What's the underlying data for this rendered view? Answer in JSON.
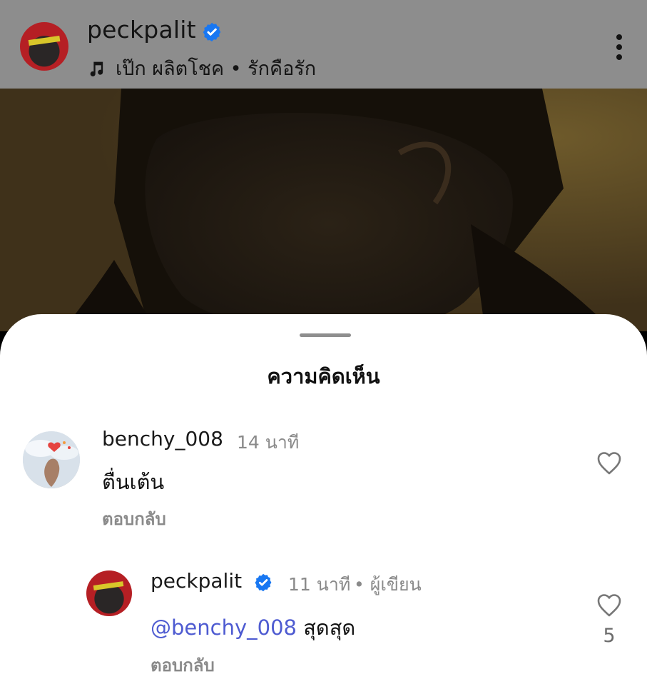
{
  "header": {
    "username": "peckpalit",
    "music": "เป๊ก ผลิตโชค • รักคือรัก",
    "icons": {
      "avatar": "profile-avatar",
      "verified": "verified-badge-icon",
      "music": "music-note-icon",
      "more": "more-options-icon"
    }
  },
  "sheet": {
    "title": "ความคิดเห็น"
  },
  "comments": [
    {
      "username": "benchy_008",
      "time": "14 นาที",
      "text": "ตื่นเต้น",
      "reply": "ตอบกลับ",
      "likes": ""
    },
    {
      "username": "peckpalit",
      "time": "11 นาที",
      "author_label": "• ผู้เขียน",
      "mention": "@benchy_008",
      "text": "สุดสุด",
      "reply": "ตอบกลับ",
      "likes": "5"
    }
  ],
  "colors": {
    "mention": "#4e5bd1",
    "verified": "#1877f2",
    "header_bg": "#8d8d8d"
  }
}
